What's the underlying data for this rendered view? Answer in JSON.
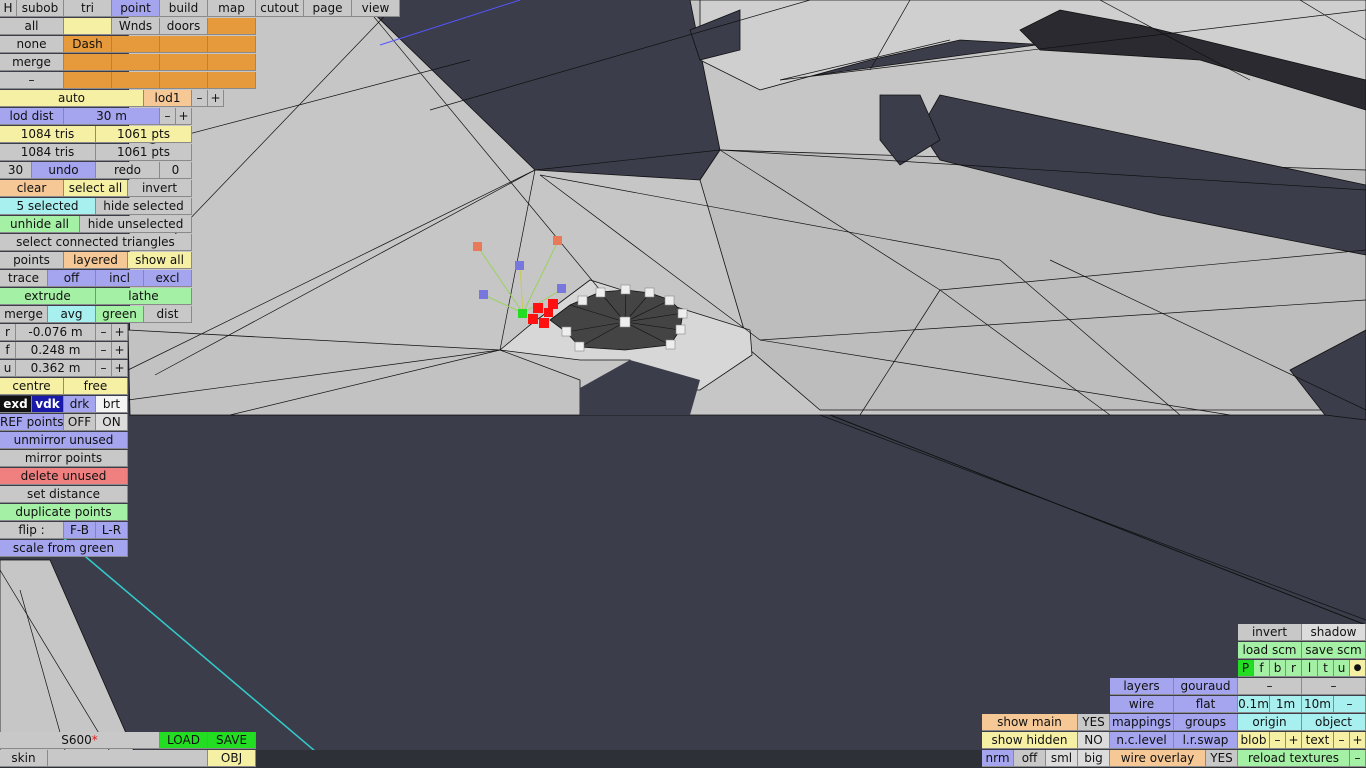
{
  "menu_bar": {
    "items": [
      "H",
      "subob",
      "tri",
      "point",
      "build",
      "map",
      "cutout",
      "page",
      "view"
    ],
    "active": "point"
  },
  "left_panel": {
    "select_all_label": "all",
    "wnds_label": "Wnds",
    "doors_label": "doors",
    "none_label": "none",
    "dash_label": "Dash",
    "merge_top_label": "merge",
    "minus_label": "–",
    "auto_label": "auto",
    "lod_label": "lod1",
    "lod_dist_label": "lod dist",
    "lod_dist_value": "30 m",
    "tris_a": "1084 tris",
    "pts_a": "1061 pts",
    "tris_b": "1084 tris",
    "pts_b": "1061 pts",
    "undo_count": "30",
    "undo_label": "undo",
    "redo_label": "redo",
    "redo_count": "0",
    "clear_label": "clear",
    "select_all_btn": "select all",
    "invert_label": "invert",
    "selected_label": "5 selected",
    "hide_selected_label": "hide selected",
    "unhide_all_label": "unhide all",
    "hide_unselected_label": "hide unselected",
    "select_connected_label": "select connected triangles",
    "points_label": "points",
    "layered_label": "layered",
    "show_all_label": "show all",
    "trace_label": "trace",
    "off_label": "off",
    "incl_label": "incl",
    "excl_label": "excl",
    "extrude_label": "extrude",
    "lathe_label": "lathe",
    "merge_label": "merge",
    "avg_label": "avg",
    "green_label": "green",
    "dist_label": "dist",
    "r_label": "r",
    "r_value": "-0.076 m",
    "f_label": "f",
    "f_value": "0.248 m",
    "u_label": "u",
    "u_value": "0.362 m",
    "plus_label": "+",
    "minus2_label": "–",
    "centre_label": "centre",
    "free_label": "free",
    "exd_label": "exd",
    "vdk_label": "vdk",
    "drk_label": "drk",
    "brt_label": "brt",
    "ref_points_label": "REF points",
    "ref_off_label": "OFF",
    "ref_on_label": "ON",
    "unmirror_label": "unmirror unused",
    "mirror_label": "mirror points",
    "delete_unused_label": "delete unused",
    "set_distance_label": "set distance",
    "duplicate_label": "duplicate points",
    "flip_label": "flip :",
    "fb_label": "F-B",
    "lr_label": "L-R",
    "scale_green_label": "scale from green"
  },
  "bottom_left": {
    "file_name": "S600",
    "modified_mark": "*",
    "load_label": "LOAD",
    "save_label": "SAVE",
    "skin_label": "skin",
    "obj_label": "OBJ"
  },
  "bottom_right": {
    "invert_label": "invert",
    "shadow_label": "shadow",
    "load_scm_label": "load scm",
    "save_scm_label": "save scm",
    "view_letters": [
      "P",
      "f",
      "b",
      "r",
      "l",
      "t",
      "u"
    ],
    "dot_label": "●",
    "layers_label": "layers",
    "gouraud_label": "gouraud",
    "dash_a": "–",
    "dash_b": "–",
    "wire_label": "wire",
    "flat_label": "flat",
    "grid_01": "0.1m",
    "grid_1": "1m",
    "grid_10": "10m",
    "grid_minus": "–",
    "show_main_label": "show main",
    "show_main_value": "YES",
    "mappings_label": "mappings",
    "groups_label": "groups",
    "origin_label": "origin",
    "object_label": "object",
    "show_hidden_label": "show hidden",
    "show_hidden_value": "NO",
    "nc_level_label": "n.c.level",
    "lr_swap_label": "l.r.swap",
    "blob_label": "blob",
    "text_label": "text",
    "minus_label": "–",
    "plus_label": "+",
    "nrm_label": "nrm",
    "off_label": "off",
    "sml_label": "sml",
    "big_label": "big",
    "wire_overlay_label": "wire overlay",
    "wire_overlay_value": "YES",
    "reload_textures_label": "reload textures"
  },
  "colors": {
    "viewport_bg": "#3b3d4a",
    "mesh_fill": "#c6c6c6",
    "selected_point": "#ff1111",
    "green_point": "#22dd22"
  }
}
